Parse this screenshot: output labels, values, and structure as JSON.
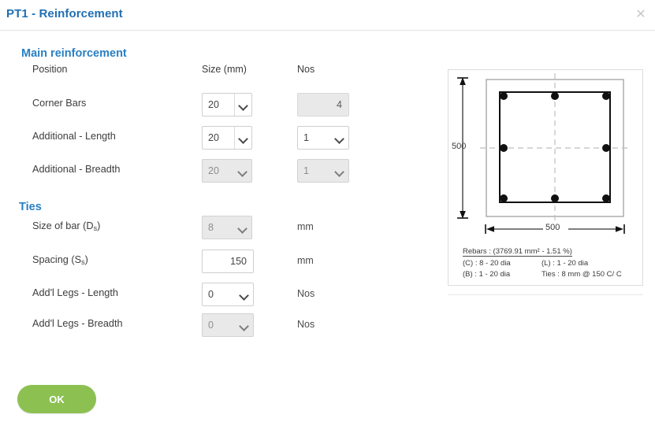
{
  "dialog": {
    "title": "PT1 - Reinforcement",
    "close_icon": "close-icon",
    "ok_label": "OK"
  },
  "sections": {
    "main": {
      "heading": "Main reinforcement",
      "columns": {
        "position": "Position",
        "size": "Size (mm)",
        "nos": "Nos"
      },
      "rows": [
        {
          "label": "Corner Bars",
          "size": "20",
          "nos": "4",
          "size_disabled": false,
          "nos_kind": "readonly"
        },
        {
          "label": "Additional - Length",
          "size": "20",
          "nos": "1",
          "size_disabled": false,
          "nos_kind": "select"
        },
        {
          "label": "Additional - Breadth",
          "size": "20",
          "nos": "1",
          "size_disabled": true,
          "nos_kind": "select-disabled"
        }
      ]
    },
    "ties": {
      "heading": "Ties",
      "rows": [
        {
          "label": "Size of bar (D",
          "sub": "s",
          "label_end": ")",
          "value": "8",
          "unit": "mm",
          "kind": "select",
          "disabled": true
        },
        {
          "label": "Spacing (S",
          "sub": "s",
          "label_end": ")",
          "value": "150",
          "unit": "mm",
          "kind": "text",
          "disabled": false
        },
        {
          "label": "Add'l Legs - Length",
          "sub": "",
          "label_end": "",
          "value": "0",
          "unit": "Nos",
          "kind": "select",
          "disabled": false
        },
        {
          "label": "Add'l Legs - Breadth",
          "sub": "",
          "label_end": "",
          "value": "0",
          "unit": "Nos",
          "kind": "select",
          "disabled": true
        }
      ]
    }
  },
  "diagram": {
    "width_dim": "500",
    "height_dim": "500",
    "caption": {
      "line1": "Rebars : (3769.91 mm² - 1.51 %)",
      "line2_left": "(C) : 8 - 20 dia",
      "line2_right": "(L) : 1 - 20 dia",
      "line3_left": "(B) : 1 - 20 dia",
      "line3_right": "Ties : 8 mm @ 150 C/ C"
    },
    "rebar_count": 8,
    "section_shape": "square-column-cross-section"
  },
  "colors": {
    "title_blue": "#1f6fb2",
    "section_blue": "#2980c4",
    "ok_green": "#8cc152",
    "border_gray": "#cfcfcf",
    "disabled_gray": "#e9e9e9"
  }
}
